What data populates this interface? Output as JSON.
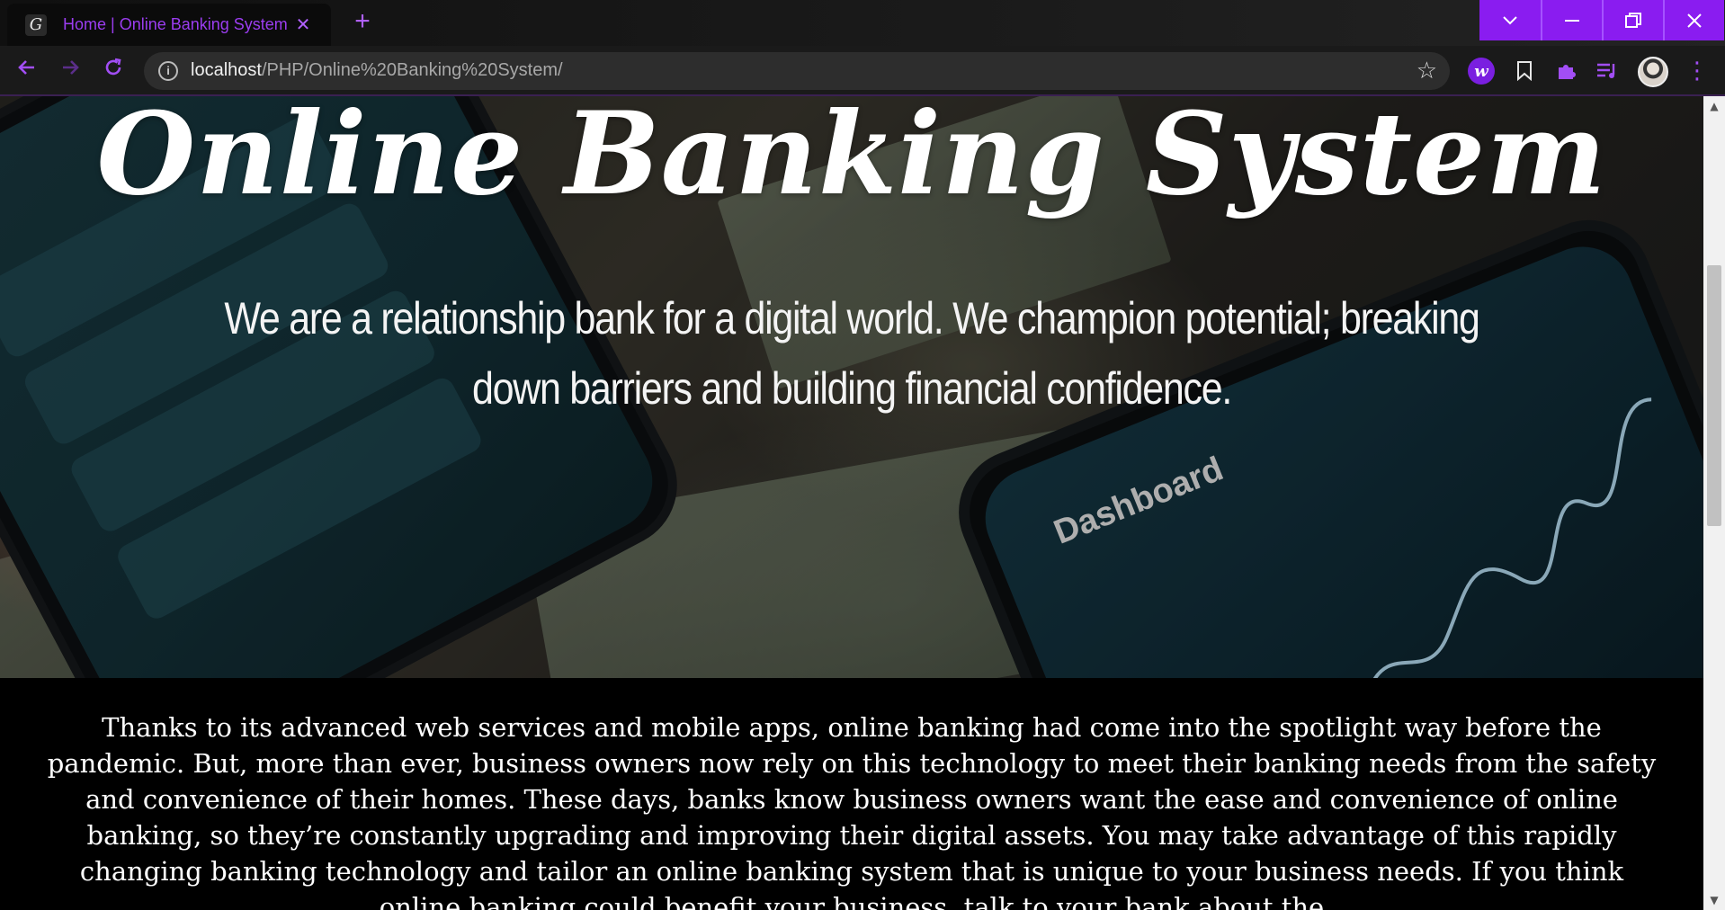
{
  "browser": {
    "tab_title": "Home | Online Banking System",
    "tab_favicon": "G",
    "url_host": "localhost",
    "url_path": "/PHP/Online%20Banking%20System/",
    "icons": {
      "back": "arrow-left-icon",
      "forward": "arrow-right-icon",
      "reload": "reload-icon",
      "info": "info-icon",
      "bookmark_star": "star-icon",
      "close_tab": "close-icon",
      "new_tab": "plus-icon"
    },
    "accent_color": "#8a1cf0"
  },
  "hero": {
    "title": "Online Banking System",
    "tagline": "We are a relationship bank for a digital world. We champion potential; breaking down barriers and building financial confidence.",
    "phone_dashboard_label": "Dashboard"
  },
  "content": {
    "paragraph": "Thanks to its advanced web services and mobile apps, online banking had come into the spotlight way before the pandemic. But, more than ever, business owners now rely on this technology to meet their banking needs from the safety and convenience of their homes. These days, banks know business owners want the ease and convenience of online banking, so they’re constantly upgrading and improving their digital assets. You may take advantage of this rapidly changing banking technology and tailor an online banking system that is unique to your business needs. If you think online banking could benefit your business, talk to your bank about the"
  }
}
